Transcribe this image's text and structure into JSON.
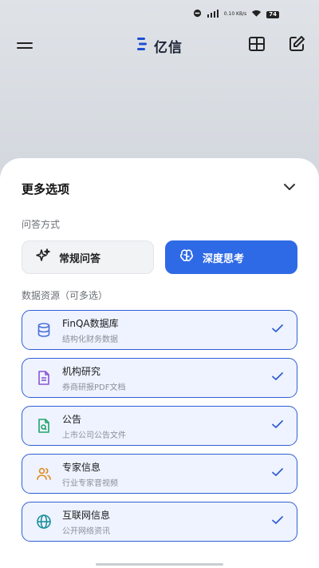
{
  "status_bar": {
    "network_speed": "0.10 KB/s",
    "battery": "74"
  },
  "header": {
    "app_title": "亿信",
    "icons": [
      "menu-icon",
      "logo-icon",
      "grid-icon",
      "edit-icon"
    ]
  },
  "sheet": {
    "title": "更多选项",
    "qa_mode_label": "问答方式",
    "modes": [
      {
        "label": "常规问答",
        "icon": "sparkle-icon",
        "active": false
      },
      {
        "label": "深度思考",
        "icon": "brain-icon",
        "active": true
      }
    ],
    "sources_label": "数据资源（可多选）",
    "sources": [
      {
        "name": "FinQA数据库",
        "desc": "结构化财务数据",
        "icon": "database-icon",
        "icon_color": "#4a6fd8",
        "checked": true
      },
      {
        "name": "机构研究",
        "desc": "券商研报PDF文档",
        "icon": "document-icon",
        "icon_color": "#8a54d6",
        "checked": true
      },
      {
        "name": "公告",
        "desc": "上市公司公告文件",
        "icon": "announcement-icon",
        "icon_color": "#23a36a",
        "checked": true
      },
      {
        "name": "专家信息",
        "desc": "行业专家音视频",
        "icon": "people-icon",
        "icon_color": "#e08a1e",
        "checked": true
      },
      {
        "name": "互联网信息",
        "desc": "公开网络资讯",
        "icon": "globe-icon",
        "icon_color": "#1c8f9c",
        "checked": true
      }
    ]
  },
  "colors": {
    "accent": "#2f6ae6",
    "card_border": "#2f5fd6",
    "card_bg": "#eef3ff"
  }
}
